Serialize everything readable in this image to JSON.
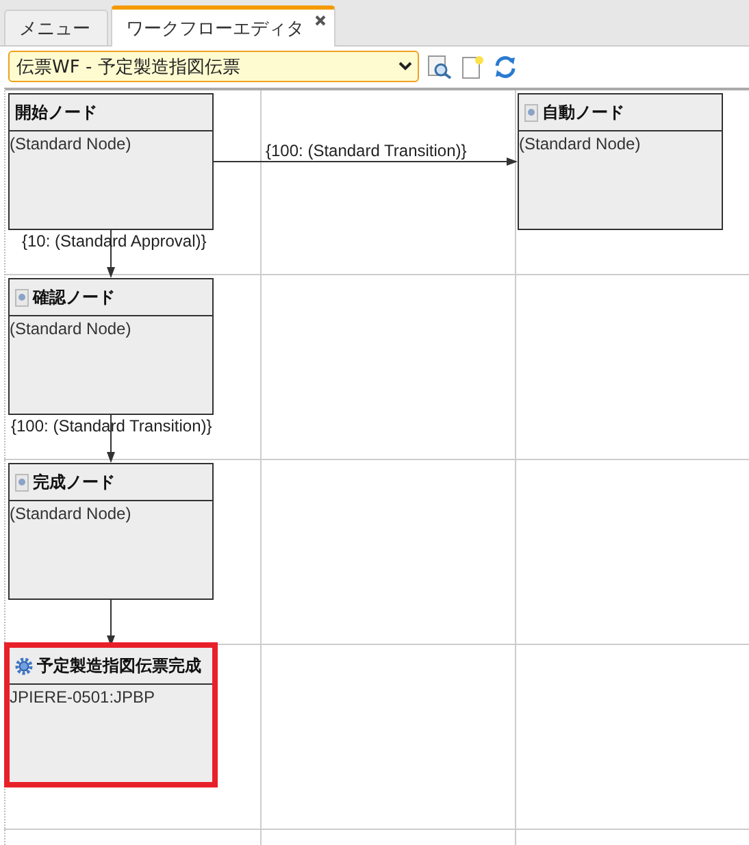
{
  "tabs": [
    {
      "label": "メニュー",
      "selected": false,
      "closable": false
    },
    {
      "label": "ワークフローエディタ",
      "selected": true,
      "closable": true
    }
  ],
  "toolbar": {
    "workflow_select": {
      "value": "伝票WF - 予定製造指図伝票"
    }
  },
  "nodes": [
    {
      "title": "開始ノード",
      "description": "(Standard Node)",
      "kind": "plain",
      "selected": false
    },
    {
      "title": "自動ノード",
      "description": "(Standard Node)",
      "kind": "document",
      "selected": false
    },
    {
      "title": "確認ノード",
      "description": "(Standard Node)",
      "kind": "document",
      "selected": false
    },
    {
      "title": "完成ノード",
      "description": "(Standard Node)",
      "kind": "document",
      "selected": false
    },
    {
      "title": "予定製造指図伝票完成",
      "description": "JPIERE-0501:JPBP",
      "kind": "gear",
      "selected": true
    }
  ],
  "transitions": [
    {
      "kind": "horizontal",
      "label": "{100: (Standard Transition)}"
    },
    {
      "kind": "vertical",
      "label": "{10: (Standard Approval)}"
    },
    {
      "kind": "vertical",
      "label": "{100: (Standard Transition)}"
    },
    {
      "kind": "vertical"
    }
  ]
}
